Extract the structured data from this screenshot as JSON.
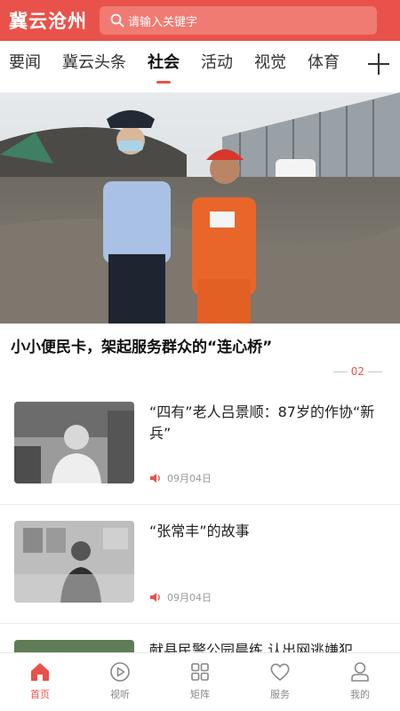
{
  "header": {
    "logo": "冀云沧州",
    "search_placeholder": "请输入关键字",
    "brand_color": "#e9524a"
  },
  "tabs": [
    {
      "label": "要闻",
      "active": false
    },
    {
      "label": "冀云头条",
      "active": false
    },
    {
      "label": "社会",
      "active": true
    },
    {
      "label": "活动",
      "active": false
    },
    {
      "label": "视觉",
      "active": false
    },
    {
      "label": "体育",
      "active": false
    }
  ],
  "hero": {
    "title": "小小便民卡，架起服务群众的“连心桥”",
    "page_indicator": "02"
  },
  "news": [
    {
      "title": "“四有”老人吕景顺：87岁的作协“新兵”",
      "date": "09月04日",
      "thumb_icon": "portrait-photo"
    },
    {
      "title": "“张常丰”的故事",
      "date": "09月04日",
      "thumb_icon": "portrait-photo"
    },
    {
      "title": "献县民警公园晨练 认出网逃嫌犯",
      "date": "",
      "thumb_icon": "outdoor-photo"
    }
  ],
  "bottom_nav": [
    {
      "label": "首页",
      "icon": "home-icon",
      "active": true
    },
    {
      "label": "视听",
      "icon": "play-icon",
      "active": false
    },
    {
      "label": "矩阵",
      "icon": "grid-icon",
      "active": false
    },
    {
      "label": "服务",
      "icon": "heart-icon",
      "active": false
    },
    {
      "label": "我的",
      "icon": "user-icon",
      "active": false
    }
  ]
}
